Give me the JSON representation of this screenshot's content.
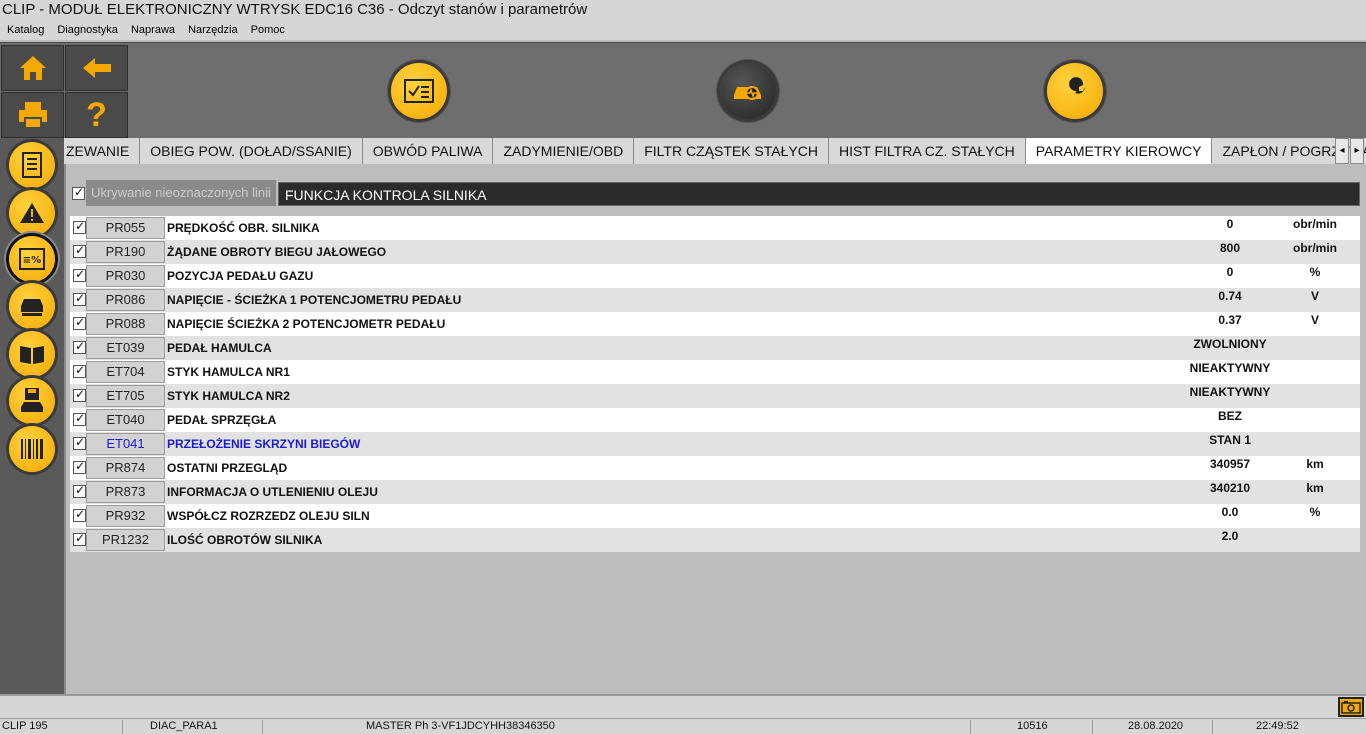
{
  "window": {
    "title": "CLIP - MODUŁ ELEKTRONICZNY WTRYSK EDC16 C36 - Odczyt stanów i parametrów"
  },
  "menu": [
    "Katalog",
    "Diagnostyka",
    "Naprawa",
    "Narzędzia",
    "Pomoc"
  ],
  "toolbar": {
    "small_buttons": [
      "home-icon",
      "back-arrow-icon",
      "printer-icon",
      "help-icon"
    ],
    "help_glyph": "?",
    "big_buttons": [
      "checklist-icon",
      "vehicle-diagnostic-icon",
      "wrench-icon"
    ]
  },
  "sidebar": {
    "icons": [
      "document-icon",
      "warning-icon",
      "parameters-icon",
      "vehicle-icon",
      "manual-book-icon",
      "save-vehicle-icon",
      "barcode-icon"
    ]
  },
  "tabs": [
    {
      "label": "ZEWANIE",
      "active": false
    },
    {
      "label": "OBIEG POW. (DOŁAD/SSANIE)",
      "active": false
    },
    {
      "label": "OBWÓD PALIWA",
      "active": false
    },
    {
      "label": "ZADYMIENIE/OBD",
      "active": false
    },
    {
      "label": "FILTR CZĄSTEK STAŁYCH",
      "active": false
    },
    {
      "label": "HIST FILTRA CZ. STAŁYCH",
      "active": false
    },
    {
      "label": "PARAMETRY KIEROWCY",
      "active": true
    },
    {
      "label": "ZAPŁON / POGRZEWANIE",
      "active": false
    }
  ],
  "tab_arrows": {
    "left": "◂",
    "right": "▸"
  },
  "filter": {
    "hide_label": "Ukrywanie nieoznaczonych linii",
    "function_name": "FUNKCJA KONTROLA SILNIKA"
  },
  "rows": [
    {
      "code": "PR055",
      "label": "PRĘDKOŚĆ OBR. SILNIKA",
      "value": "0",
      "unit": "obr/min",
      "highlight": false
    },
    {
      "code": "PR190",
      "label": "ŻĄDANE OBROTY BIEGU JAŁOWEGO",
      "value": "800",
      "unit": "obr/min",
      "highlight": false
    },
    {
      "code": "PR030",
      "label": "POZYCJA PEDAŁU GAZU",
      "value": "0",
      "unit": "%",
      "highlight": false
    },
    {
      "code": "PR086",
      "label": "NAPIĘCIE - ŚCIEŻKA 1 POTENCJOMETRU PEDAŁU",
      "value": "0.74",
      "unit": "V",
      "highlight": false
    },
    {
      "code": "PR088",
      "label": "NAPIĘCIE ŚCIEŻKA 2 POTENCJOMETR PEDAŁU",
      "value": "0.37",
      "unit": "V",
      "highlight": false
    },
    {
      "code": "ET039",
      "label": "PEDAŁ HAMULCA",
      "value": "ZWOLNIONY",
      "unit": "",
      "highlight": false
    },
    {
      "code": "ET704",
      "label": "STYK HAMULCA NR1",
      "value": "NIEAKTYWNY",
      "unit": "",
      "highlight": false
    },
    {
      "code": "ET705",
      "label": "STYK HAMULCA NR2",
      "value": "NIEAKTYWNY",
      "unit": "",
      "highlight": false
    },
    {
      "code": "ET040",
      "label": "PEDAŁ SPRZĘGŁA",
      "value": "BEZ",
      "unit": "",
      "highlight": false
    },
    {
      "code": "ET041",
      "label": "PRZEŁOŻENIE SKRZYNI BIEGÓW",
      "value": "STAN 1",
      "unit": "",
      "highlight": true
    },
    {
      "code": "PR874",
      "label": "OSTATNI PRZEGLĄD",
      "value": "340957",
      "unit": "km",
      "highlight": false
    },
    {
      "code": "PR873",
      "label": "INFORMACJA O UTLENIENIU OLEJU",
      "value": "340210",
      "unit": "km",
      "highlight": false
    },
    {
      "code": "PR932",
      "label": "WSPÓŁCZ ROZRZEDZ OLEJU SILN",
      "value": "0.0",
      "unit": "%",
      "highlight": false
    },
    {
      "code": "PR1232",
      "label": "ILOŚĆ OBROTÓW SILNIKA",
      "value": "2.0",
      "unit": "",
      "highlight": false
    }
  ],
  "status": {
    "clip": "CLIP 195",
    "mode": "DIAC_PARA1",
    "vehicle": "MASTER Ph 3-VF1JDCYHH38346350",
    "code": "10516",
    "date": "28.08.2020",
    "time": "22:49:52"
  },
  "colors": {
    "accent": "#f5a800",
    "highlight_text": "#1a1ad6"
  }
}
